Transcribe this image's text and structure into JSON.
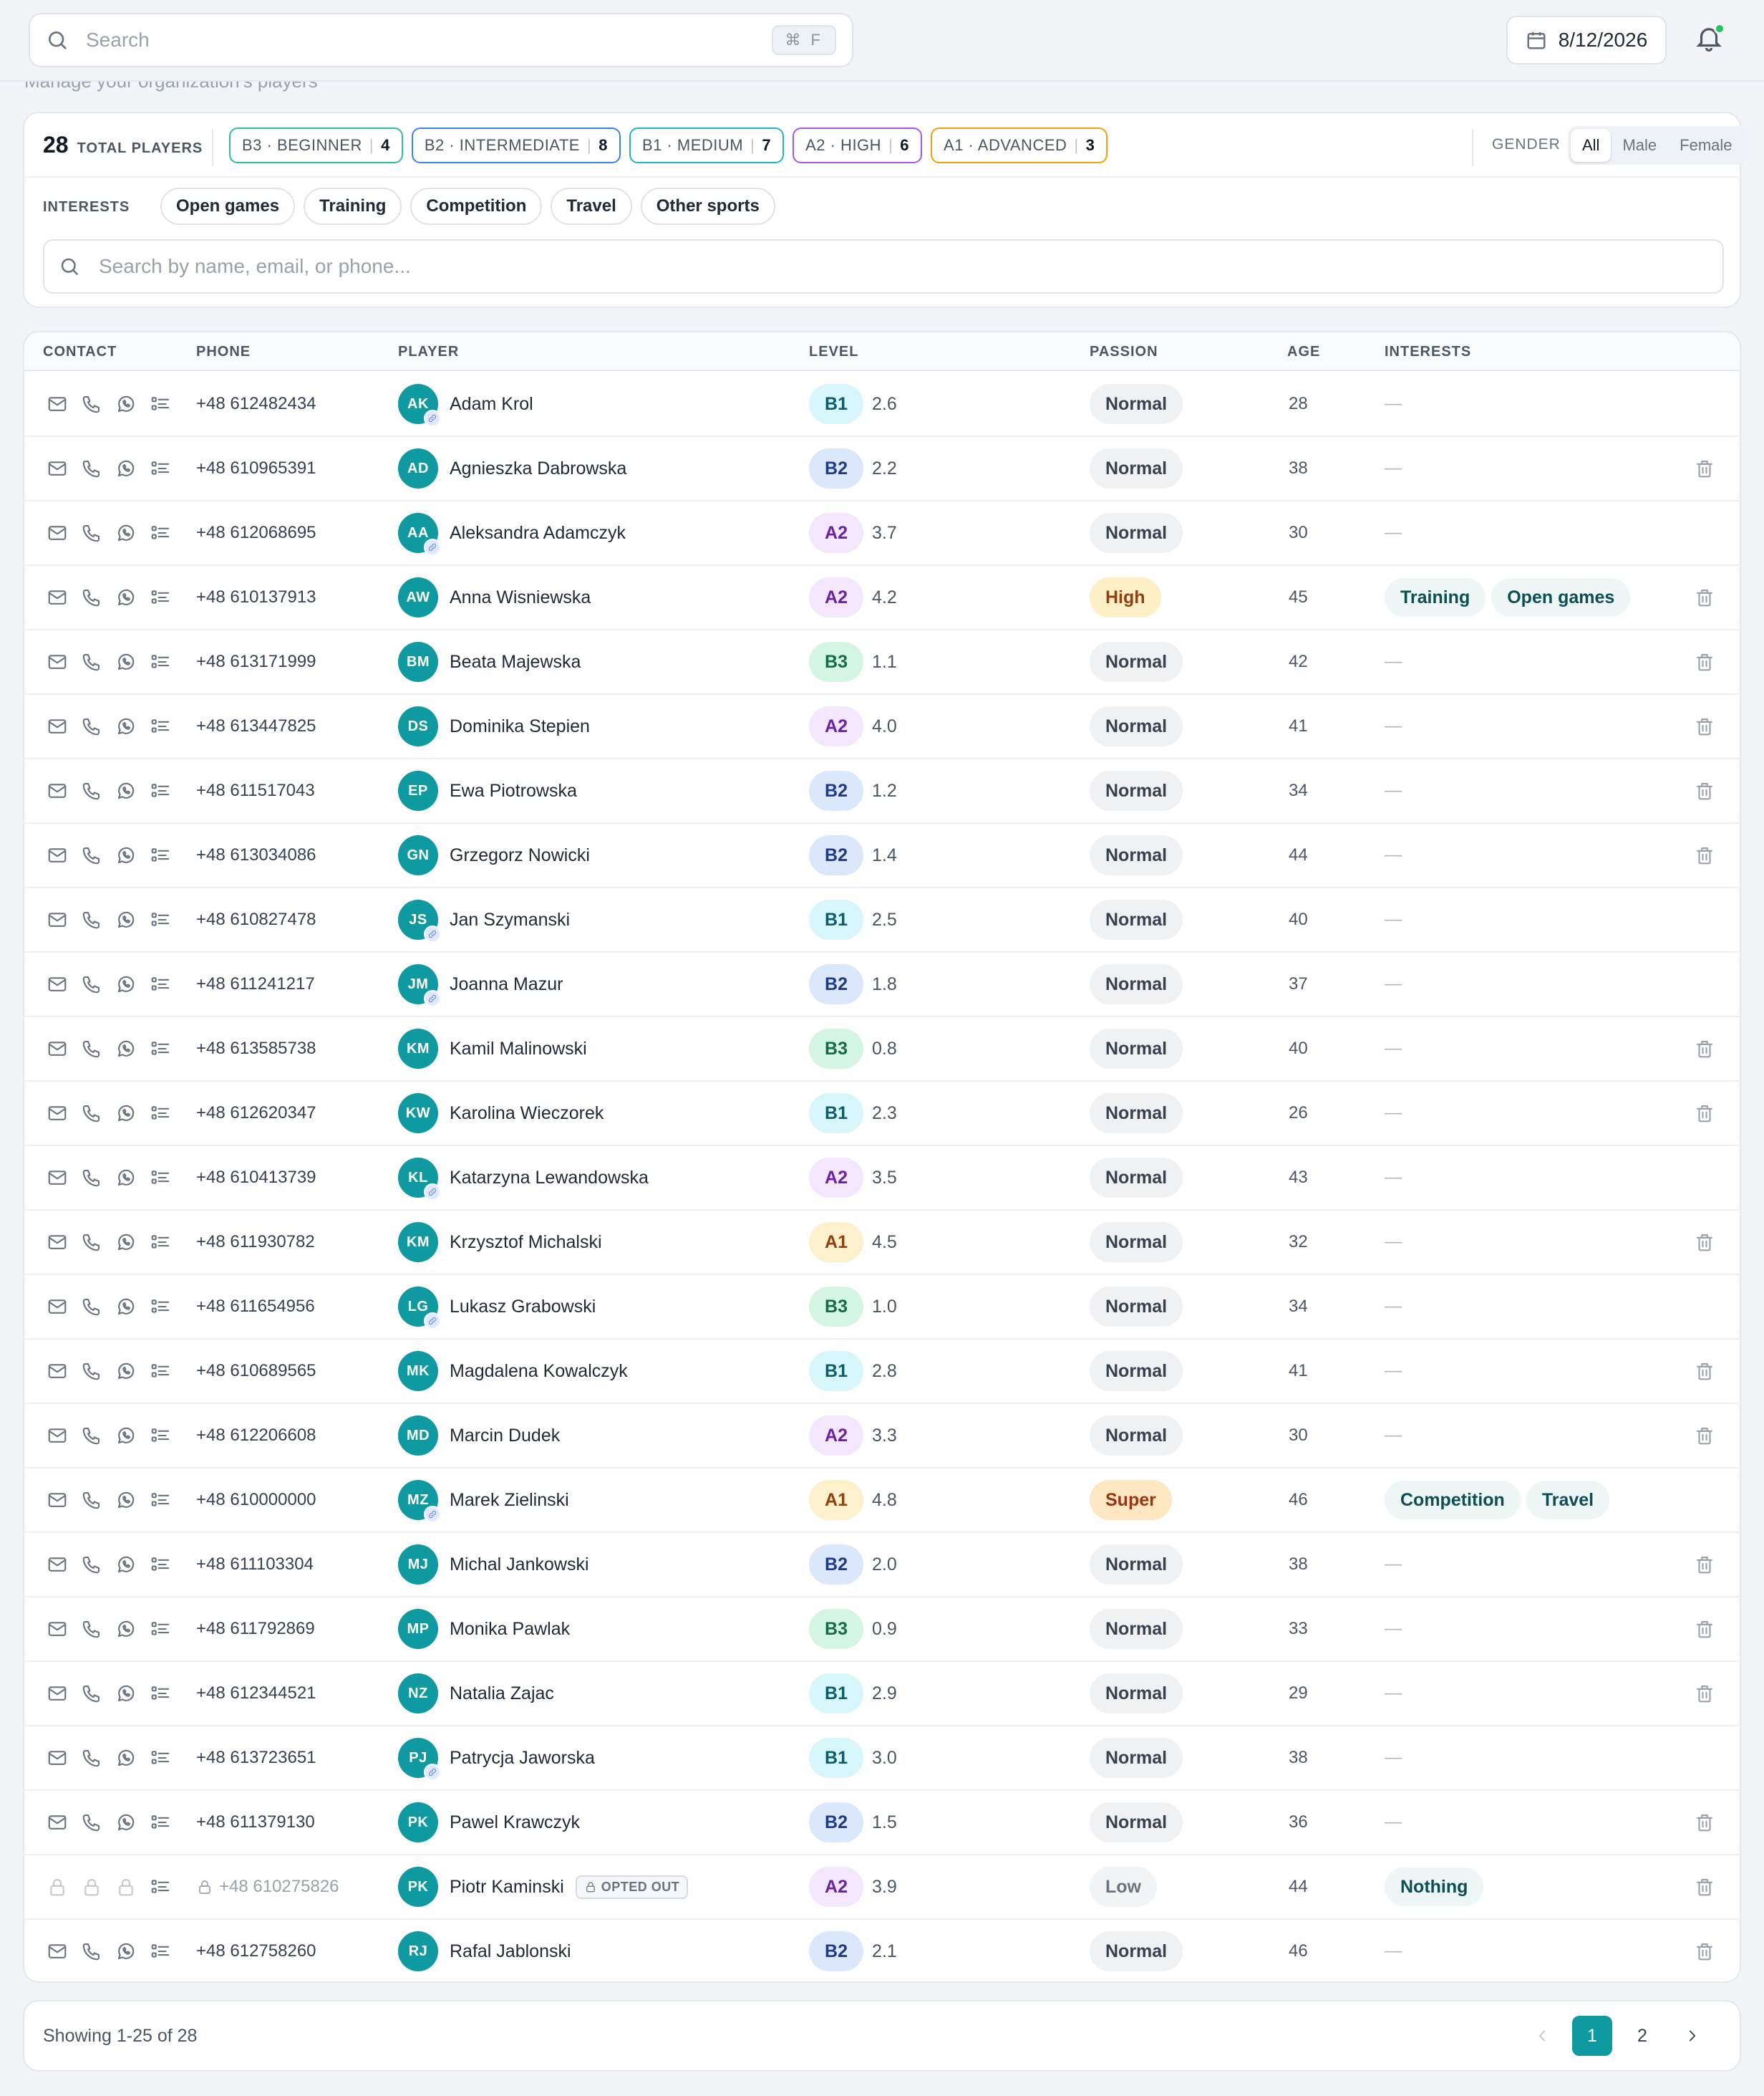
{
  "topbar": {
    "search_placeholder": "Search",
    "search_shortcut": "⌘ F",
    "date": "8/12/2026",
    "subtitle_peek": "Manage your organization's players"
  },
  "summary": {
    "total_count": "28",
    "total_label": "TOTAL PLAYERS",
    "levels": [
      {
        "label": "B3 · BEGINNER",
        "count": "4",
        "color": "#2fbf8f"
      },
      {
        "label": "B2 · INTERMEDIATE",
        "count": "8",
        "color": "#3b82f6"
      },
      {
        "label": "B1 · MEDIUM",
        "count": "7",
        "color": "#22b3c5"
      },
      {
        "label": "A2 · HIGH",
        "count": "6",
        "color": "#a855f7"
      },
      {
        "label": "A1 · ADVANCED",
        "count": "3",
        "color": "#f59e0b"
      }
    ],
    "gender_label": "GENDER",
    "gender_options": [
      "All",
      "Male",
      "Female"
    ],
    "gender_selected": "All",
    "interests_label": "INTERESTS",
    "interest_filters": [
      "Open games",
      "Training",
      "Competition",
      "Travel",
      "Other sports"
    ],
    "player_search_placeholder": "Search by name, email, or phone..."
  },
  "table": {
    "headers": [
      "CONTACT",
      "PHONE",
      "PLAYER",
      "LEVEL",
      "PASSION",
      "AGE",
      "INTERESTS"
    ],
    "level_styles": {
      "B1": {
        "bg": "#d7f6fa",
        "fg": "#0c5d6b"
      },
      "B2": {
        "bg": "#dbe7fb",
        "fg": "#1e3a8a"
      },
      "B3": {
        "bg": "#d5f5e3",
        "fg": "#146c43"
      },
      "A2": {
        "bg": "#f3e6fd",
        "fg": "#6b21a8"
      },
      "A1": {
        "bg": "#fdf1cd",
        "fg": "#92400e"
      }
    },
    "passion_styles": {
      "Normal": {
        "bg": "#f0f1f3",
        "fg": "#374151"
      },
      "High": {
        "bg": "#fdefc6",
        "fg": "#92400e"
      },
      "Super": {
        "bg": "#fde6c2",
        "fg": "#9a3412"
      },
      "Low": {
        "bg": "#f3f4f6",
        "fg": "#6b7280"
      }
    },
    "empty_interest": "—",
    "rows": [
      {
        "phone": "+48 612482434",
        "initials": "AK",
        "name": "Adam Krol",
        "linked": true,
        "level": "B1",
        "level_value": "2.6",
        "passion": "Normal",
        "age": "28",
        "interests": [],
        "delete": false
      },
      {
        "phone": "+48 610965391",
        "initials": "AD",
        "name": "Agnieszka Dabrowska",
        "linked": false,
        "level": "B2",
        "level_value": "2.2",
        "passion": "Normal",
        "age": "38",
        "interests": [],
        "delete": true
      },
      {
        "phone": "+48 612068695",
        "initials": "AA",
        "name": "Aleksandra Adamczyk",
        "linked": true,
        "level": "A2",
        "level_value": "3.7",
        "passion": "Normal",
        "age": "30",
        "interests": [],
        "delete": false
      },
      {
        "phone": "+48 610137913",
        "initials": "AW",
        "name": "Anna Wisniewska",
        "linked": false,
        "level": "A2",
        "level_value": "4.2",
        "passion": "High",
        "age": "45",
        "interests": [
          "Training",
          "Open games"
        ],
        "delete": true
      },
      {
        "phone": "+48 613171999",
        "initials": "BM",
        "name": "Beata Majewska",
        "linked": false,
        "level": "B3",
        "level_value": "1.1",
        "passion": "Normal",
        "age": "42",
        "interests": [],
        "delete": true
      },
      {
        "phone": "+48 613447825",
        "initials": "DS",
        "name": "Dominika Stepien",
        "linked": false,
        "level": "A2",
        "level_value": "4.0",
        "passion": "Normal",
        "age": "41",
        "interests": [],
        "delete": true
      },
      {
        "phone": "+48 611517043",
        "initials": "EP",
        "name": "Ewa Piotrowska",
        "linked": false,
        "level": "B2",
        "level_value": "1.2",
        "passion": "Normal",
        "age": "34",
        "interests": [],
        "delete": true
      },
      {
        "phone": "+48 613034086",
        "initials": "GN",
        "name": "Grzegorz Nowicki",
        "linked": false,
        "level": "B2",
        "level_value": "1.4",
        "passion": "Normal",
        "age": "44",
        "interests": [],
        "delete": true
      },
      {
        "phone": "+48 610827478",
        "initials": "JS",
        "name": "Jan Szymanski",
        "linked": true,
        "level": "B1",
        "level_value": "2.5",
        "passion": "Normal",
        "age": "40",
        "interests": [],
        "delete": false
      },
      {
        "phone": "+48 611241217",
        "initials": "JM",
        "name": "Joanna Mazur",
        "linked": true,
        "level": "B2",
        "level_value": "1.8",
        "passion": "Normal",
        "age": "37",
        "interests": [],
        "delete": false
      },
      {
        "phone": "+48 613585738",
        "initials": "KM",
        "name": "Kamil Malinowski",
        "linked": false,
        "level": "B3",
        "level_value": "0.8",
        "passion": "Normal",
        "age": "40",
        "interests": [],
        "delete": true
      },
      {
        "phone": "+48 612620347",
        "initials": "KW",
        "name": "Karolina Wieczorek",
        "linked": false,
        "level": "B1",
        "level_value": "2.3",
        "passion": "Normal",
        "age": "26",
        "interests": [],
        "delete": true
      },
      {
        "phone": "+48 610413739",
        "initials": "KL",
        "name": "Katarzyna Lewandowska",
        "linked": true,
        "level": "A2",
        "level_value": "3.5",
        "passion": "Normal",
        "age": "43",
        "interests": [],
        "delete": false
      },
      {
        "phone": "+48 611930782",
        "initials": "KM",
        "name": "Krzysztof Michalski",
        "linked": false,
        "level": "A1",
        "level_value": "4.5",
        "passion": "Normal",
        "age": "32",
        "interests": [],
        "delete": true
      },
      {
        "phone": "+48 611654956",
        "initials": "LG",
        "name": "Lukasz Grabowski",
        "linked": true,
        "level": "B3",
        "level_value": "1.0",
        "passion": "Normal",
        "age": "34",
        "interests": [],
        "delete": false
      },
      {
        "phone": "+48 610689565",
        "initials": "MK",
        "name": "Magdalena Kowalczyk",
        "linked": false,
        "level": "B1",
        "level_value": "2.8",
        "passion": "Normal",
        "age": "41",
        "interests": [],
        "delete": true
      },
      {
        "phone": "+48 612206608",
        "initials": "MD",
        "name": "Marcin Dudek",
        "linked": false,
        "level": "A2",
        "level_value": "3.3",
        "passion": "Normal",
        "age": "30",
        "interests": [],
        "delete": true
      },
      {
        "phone": "+48 610000000",
        "initials": "MZ",
        "name": "Marek Zielinski",
        "linked": true,
        "level": "A1",
        "level_value": "4.8",
        "passion": "Super",
        "age": "46",
        "interests": [
          "Competition",
          "Travel"
        ],
        "delete": false
      },
      {
        "phone": "+48 611103304",
        "initials": "MJ",
        "name": "Michal Jankowski",
        "linked": false,
        "level": "B2",
        "level_value": "2.0",
        "passion": "Normal",
        "age": "38",
        "interests": [],
        "delete": true
      },
      {
        "phone": "+48 611792869",
        "initials": "MP",
        "name": "Monika Pawlak",
        "linked": false,
        "level": "B3",
        "level_value": "0.9",
        "passion": "Normal",
        "age": "33",
        "interests": [],
        "delete": true
      },
      {
        "phone": "+48 612344521",
        "initials": "NZ",
        "name": "Natalia Zajac",
        "linked": false,
        "level": "B1",
        "level_value": "2.9",
        "passion": "Normal",
        "age": "29",
        "interests": [],
        "delete": true
      },
      {
        "phone": "+48 613723651",
        "initials": "PJ",
        "name": "Patrycja Jaworska",
        "linked": true,
        "level": "B1",
        "level_value": "3.0",
        "passion": "Normal",
        "age": "38",
        "interests": [],
        "delete": false
      },
      {
        "phone": "+48 611379130",
        "initials": "PK",
        "name": "Pawel Krawczyk",
        "linked": false,
        "level": "B2",
        "level_value": "1.5",
        "passion": "Normal",
        "age": "36",
        "interests": [],
        "delete": true
      },
      {
        "phone": "+48 610275826",
        "initials": "PK",
        "name": "Piotr Kaminski",
        "linked": false,
        "opted_out": true,
        "opted_label": "OPTED OUT",
        "level": "A2",
        "level_value": "3.9",
        "passion": "Low",
        "age": "44",
        "interests": [
          "Nothing"
        ],
        "delete": true
      },
      {
        "phone": "+48 612758260",
        "initials": "RJ",
        "name": "Rafal Jablonski",
        "linked": false,
        "level": "B2",
        "level_value": "2.1",
        "passion": "Normal",
        "age": "46",
        "interests": [],
        "delete": true
      }
    ]
  },
  "footer": {
    "showing": "Showing 1-25 of 28",
    "pages": [
      "1",
      "2"
    ],
    "current_page": "1"
  }
}
